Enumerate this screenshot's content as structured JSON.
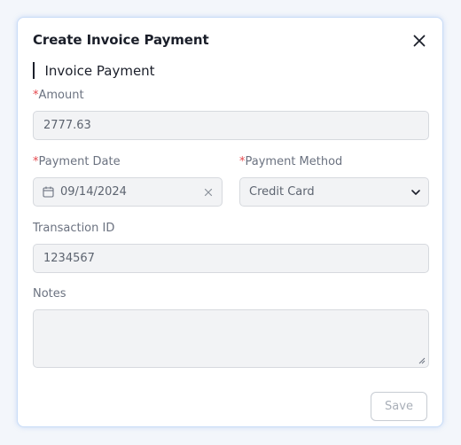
{
  "modal": {
    "title": "Create Invoice Payment",
    "section_title": "Invoice Payment"
  },
  "form": {
    "amount": {
      "required_mark": "*",
      "label": "Amount",
      "value": "2777.63"
    },
    "payment_date": {
      "required_mark": "*",
      "label": "Payment Date",
      "value": "09/14/2024"
    },
    "payment_method": {
      "required_mark": "*",
      "label": "Payment Method",
      "value": "Credit Card"
    },
    "transaction_id": {
      "label": "Transaction ID",
      "value": "1234567"
    },
    "notes": {
      "label": "Notes",
      "value": ""
    }
  },
  "actions": {
    "save_label": "Save"
  },
  "icons": {
    "close": "close-icon",
    "calendar": "calendar-icon",
    "clear": "clear-icon",
    "dropdown": "chevron-down-icon"
  },
  "colors": {
    "required": "#e5484d",
    "field_bg": "#f2f3f5",
    "modal_border": "#c9dcf7",
    "save_disabled_text": "#a9afb8"
  }
}
